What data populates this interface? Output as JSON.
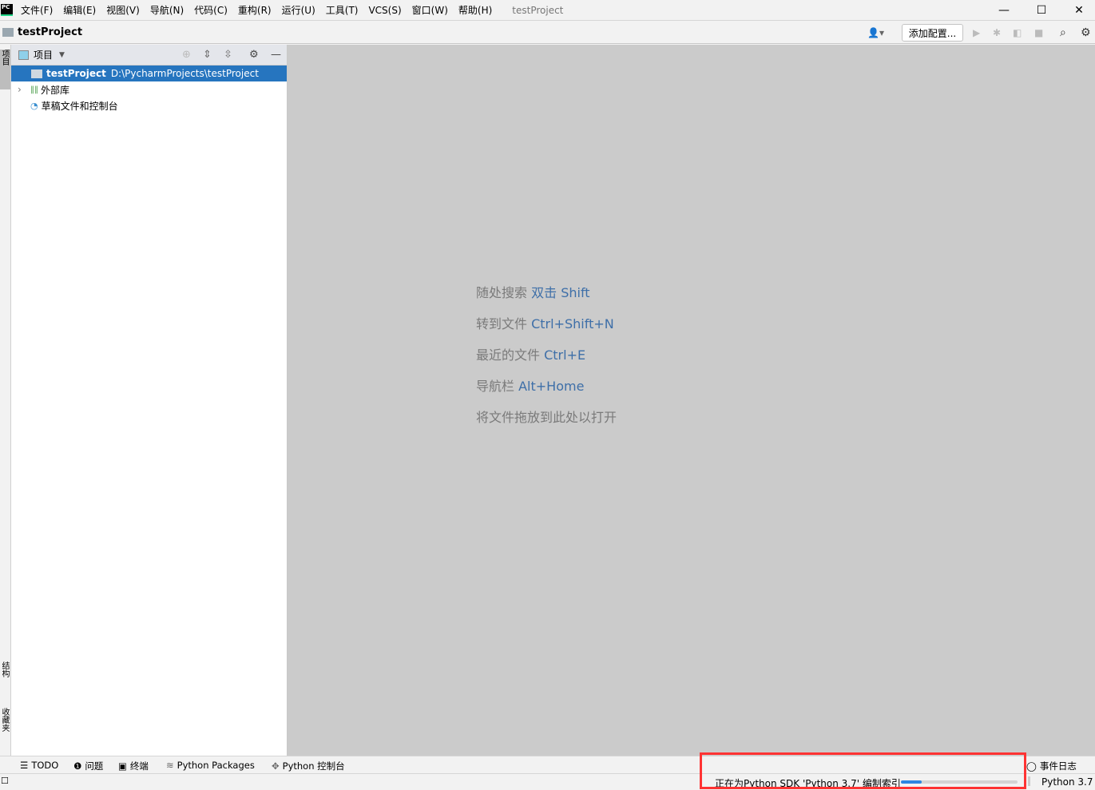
{
  "menubar": {
    "logo": "PC",
    "items": [
      "文件(F)",
      "编辑(E)",
      "视图(V)",
      "导航(N)",
      "代码(C)",
      "重构(R)",
      "运行(U)",
      "工具(T)",
      "VCS(S)",
      "窗口(W)",
      "帮助(H)"
    ],
    "window_title": "testProject"
  },
  "navbar": {
    "project": "testProject",
    "add_config": "添加配置..."
  },
  "left_strip": {
    "tabs": [
      "项目",
      "结构",
      "收藏夹"
    ]
  },
  "panel": {
    "title": "项目",
    "tree": [
      {
        "name": "testProject",
        "path": "D:\\PycharmProjects\\testProject",
        "selected": true
      },
      {
        "name": "外部库"
      },
      {
        "name": "草稿文件和控制台"
      }
    ]
  },
  "editor": {
    "hints": [
      {
        "text": "随处搜索",
        "key": "双击 Shift"
      },
      {
        "text": "转到文件",
        "key": "Ctrl+Shift+N"
      },
      {
        "text": "最近的文件",
        "key": "Ctrl+E"
      },
      {
        "text": "导航栏",
        "key": "Alt+Home"
      },
      {
        "text": "将文件拖放到此处以打开",
        "key": ""
      }
    ]
  },
  "bottom_tabs": [
    "TODO",
    "问题",
    "终端",
    "Python Packages",
    "Python 控制台"
  ],
  "event_log": "事件日志",
  "status": {
    "indexing": "正在为Python SDK 'Python 3.7' 编制索引",
    "progress_percent": 18,
    "interpreter": "Python 3.7"
  },
  "colors": {
    "selection": "#2675bf",
    "highlight_box": "#ff3333",
    "progress": "#2d87e2",
    "shortcut": "#3e6fa8"
  }
}
